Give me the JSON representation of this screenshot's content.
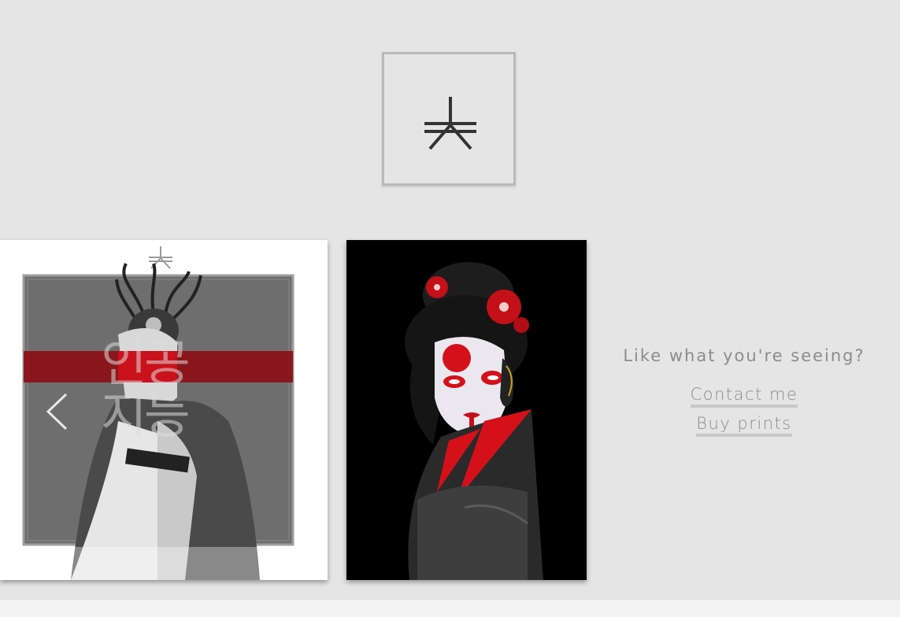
{
  "logo": {
    "icon": "kanji-logo-icon"
  },
  "gallery": {
    "items": [
      {
        "title_korean": "인공지능",
        "title_line1": "인공",
        "title_line2": "지능",
        "image": "cyborg-woman-artwork"
      },
      {
        "image": "geisha-robot-artwork"
      }
    ],
    "prev_icon": "chevron-left-icon"
  },
  "cta": {
    "heading": "Like what you're seeing?",
    "contact_label": "Contact me",
    "prints_label": "Buy prints"
  },
  "colors": {
    "background": "#e5e5e5",
    "accent_red": "#d4111b",
    "text_gray": "#8c8c8c"
  }
}
